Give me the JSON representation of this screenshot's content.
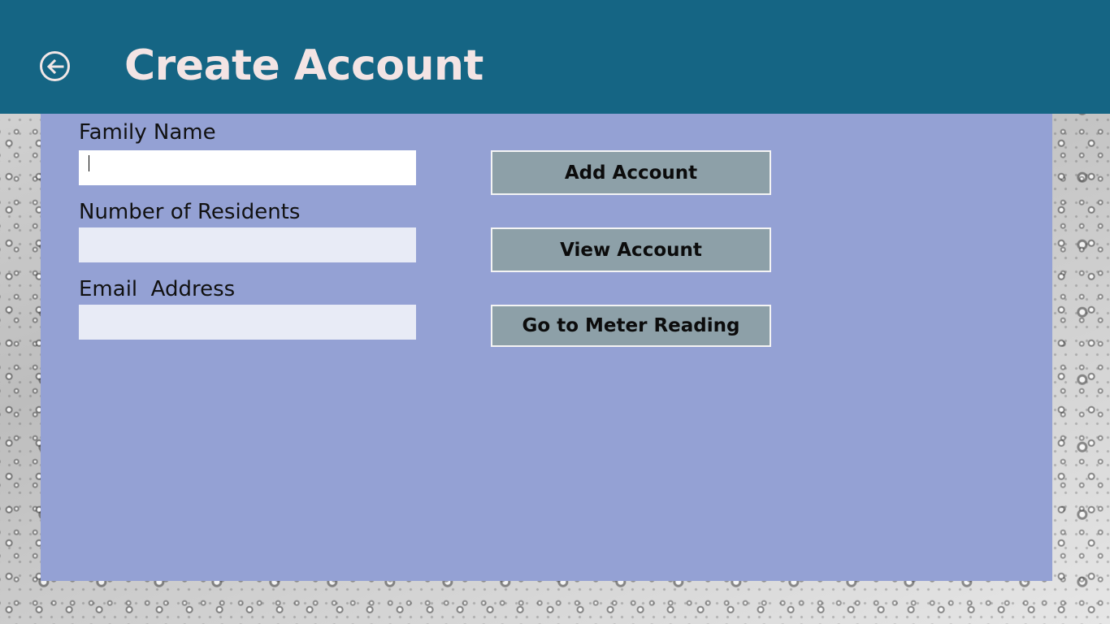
{
  "header": {
    "title": "Create Account",
    "back_icon": "arrow-left-circle-icon"
  },
  "form": {
    "family_name": {
      "label": "Family Name",
      "value": ""
    },
    "residents": {
      "label": "Number of Residents",
      "value": ""
    },
    "email": {
      "label": "Email  Address",
      "value": ""
    }
  },
  "actions": {
    "add_account": "Add Account",
    "view_account": "View Account",
    "meter_reading": "Go to Meter Reading"
  },
  "colors": {
    "header_bg": "#156584",
    "panel_bg": "#94a1d4",
    "button_bg": "#8da0a8",
    "title_text": "#f3e4e4"
  }
}
